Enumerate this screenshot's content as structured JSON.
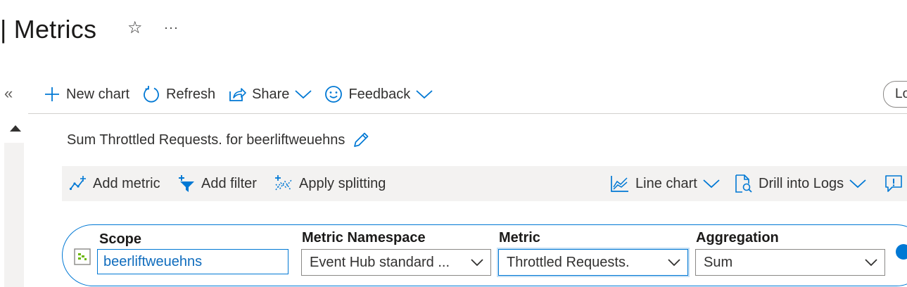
{
  "header": {
    "title": "| Metrics",
    "favorite_icon": "star-icon",
    "more_label": "···"
  },
  "toolbar": {
    "collapse_label": "«",
    "new_chart_label": "New chart",
    "refresh_label": "Refresh",
    "share_label": "Share",
    "feedback_label": "Feedback",
    "logs_label": "Lo"
  },
  "chart": {
    "title": "Sum Throttled Requests. for beerliftweuehns"
  },
  "metric_toolbar": {
    "add_metric_label": "Add metric",
    "add_filter_label": "Add filter",
    "apply_splitting_label": "Apply splitting",
    "line_chart_label": "Line chart",
    "drill_into_logs_label": "Drill into Logs"
  },
  "metric_row": {
    "scope_label": "Scope",
    "scope_value": "beerliftweuehns",
    "namespace_label": "Metric Namespace",
    "namespace_value": "Event Hub standard ...",
    "metric_label": "Metric",
    "metric_value": "Throttled Requests.",
    "aggregation_label": "Aggregation",
    "aggregation_value": "Sum"
  },
  "colors": {
    "accent": "#0078d4",
    "text": "#323130",
    "toolbar_bg": "#f3f2f1"
  }
}
